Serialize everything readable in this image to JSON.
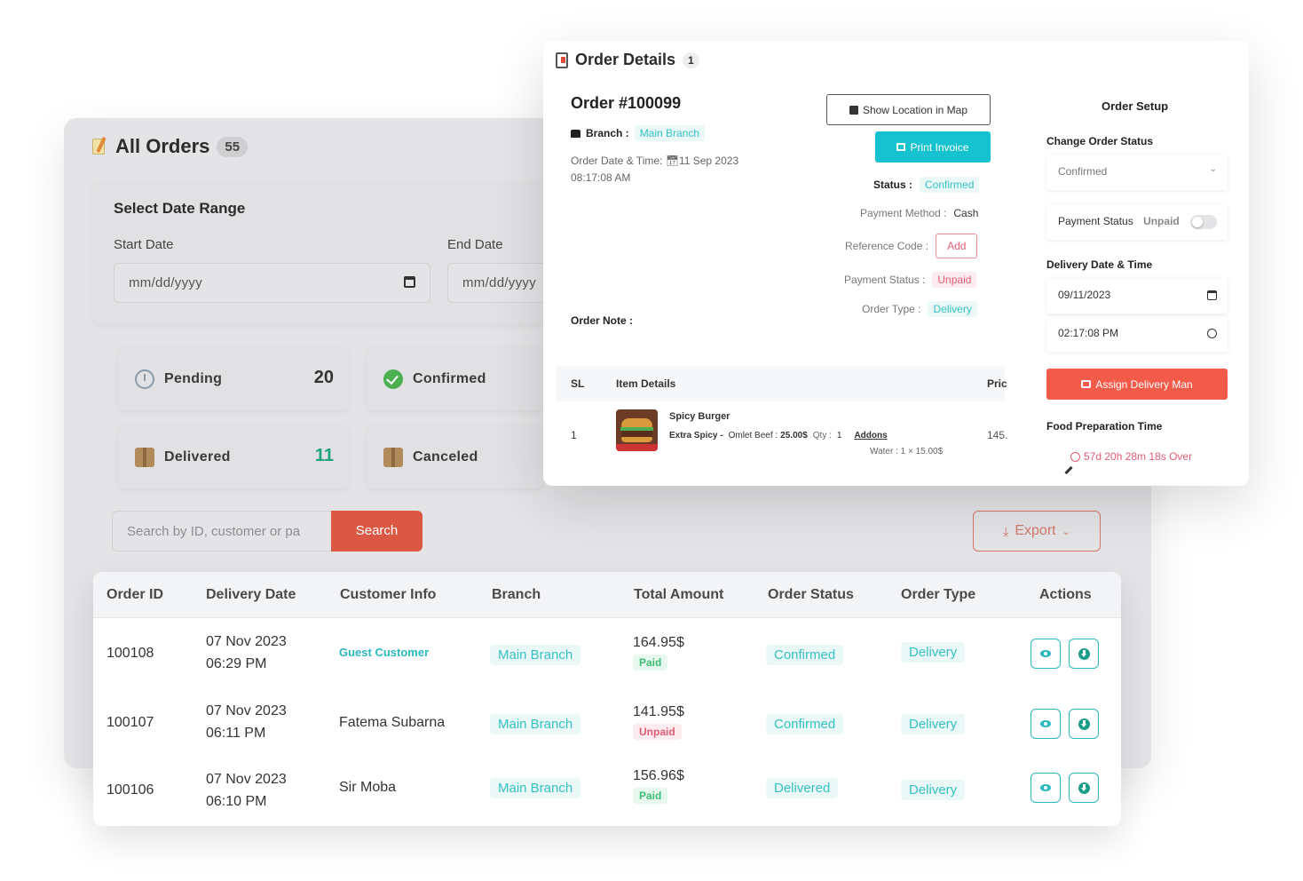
{
  "all_orders": {
    "title": "All Orders",
    "count": "55",
    "date_range": {
      "heading": "Select Date Range",
      "start_label": "Start Date",
      "end_label": "End Date",
      "start_placeholder": "mm/dd/yyyy",
      "end_placeholder": "mm/dd/yyyy"
    },
    "stats": [
      {
        "label": "Pending",
        "value": "20",
        "color": "#333333",
        "icon": "clock-icon"
      },
      {
        "label": "Confirmed",
        "value": "",
        "color": "#333333",
        "icon": "check-circle-icon"
      },
      {
        "label": "Delivered",
        "value": "11",
        "color": "#1fa37a",
        "icon": "box-icon"
      },
      {
        "label": "Canceled",
        "value": "",
        "color": "#333333",
        "icon": "box-icon"
      }
    ],
    "search": {
      "placeholder": "Search by ID, customer or pa",
      "button_label": "Search"
    },
    "export_label": "Export",
    "table": {
      "headers": [
        "Order ID",
        "Delivery Date",
        "Customer Info",
        "Branch",
        "Total Amount",
        "Order Status",
        "Order Type",
        "Actions"
      ],
      "rows": [
        {
          "id": "100108",
          "date": "07 Nov 2023",
          "time": "06:29 PM",
          "customer": "Guest Customer",
          "branch": "Main Branch",
          "total": "164.95$",
          "payment": "Paid",
          "status": "Confirmed",
          "type": "Delivery"
        },
        {
          "id": "100107",
          "date": "07 Nov 2023",
          "time": "06:11 PM",
          "customer": "Fatema Subarna",
          "branch": "Main Branch",
          "total": "141.95$",
          "payment": "Unpaid",
          "status": "Confirmed",
          "type": "Delivery"
        },
        {
          "id": "100106",
          "date": "07 Nov 2023",
          "time": "06:10 PM",
          "customer": "Sir Moba",
          "branch": "Main Branch",
          "total": "156.96$",
          "payment": "Paid",
          "status": "Delivered",
          "type": "Delivery"
        }
      ]
    }
  },
  "order_details": {
    "title": "Order Details",
    "count": "1",
    "order_number": "Order #100099",
    "branch_label": "Branch :",
    "branch_value": "Main Branch",
    "datetime_label": "Order Date & Time:",
    "date_value": "11 Sep 2023",
    "time_value": "08:17:08 AM",
    "show_location_label": "Show Location in Map",
    "print_invoice_label": "Print Invoice",
    "status_label": "Status :",
    "status_value": "Confirmed",
    "payment_method_label": "Payment Method :",
    "payment_method_value": "Cash",
    "reference_code_label": "Reference Code :",
    "reference_add_label": "Add",
    "payment_status_label": "Payment Status :",
    "payment_status_value": "Unpaid",
    "order_type_label": "Order Type :",
    "order_type_value": "Delivery",
    "order_note_label": "Order Note :",
    "items_headers": {
      "sl": "SL",
      "details": "Item Details",
      "price": "Pric"
    },
    "item": {
      "sl": "1",
      "name": "Spicy Burger",
      "variation": "Extra Spicy -",
      "option": "Omlet Beef :",
      "option_price": "25.00$",
      "qty_label": "Qty :",
      "qty": "1",
      "addons_label": "Addons",
      "addon_line": "Water : 1 × 15.00$",
      "price": "145."
    }
  },
  "order_setup": {
    "title": "Order Setup",
    "change_status_label": "Change Order Status",
    "status_selected": "Confirmed",
    "payment_status_label": "Payment Status",
    "payment_status_value": "Unpaid",
    "delivery_datetime_label": "Delivery Date & Time",
    "delivery_date": "09/11/2023",
    "delivery_time": "02:17:08 PM",
    "assign_button_label": "Assign Delivery Man",
    "prep_time_label": "Food Preparation Time",
    "prep_time_value": "57d 20h 28m 18s Over"
  },
  "colors": {
    "accent_teal": "#17c2d0",
    "danger_red": "#f25b4a",
    "search_red": "#dc5844"
  }
}
